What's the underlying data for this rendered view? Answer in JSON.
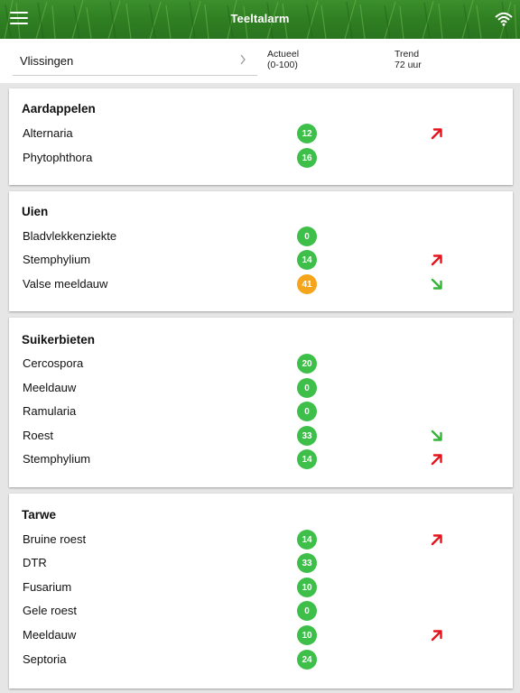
{
  "header": {
    "title": "Teeltalarm"
  },
  "location": {
    "name": "Vlissingen"
  },
  "columns": {
    "actueel": {
      "line1": "Actueel",
      "line2": "(0-100)"
    },
    "trend": {
      "line1": "Trend",
      "line2": "72 uur"
    }
  },
  "colors": {
    "green": "#3dbf4a",
    "orange": "#f4a51b",
    "arrow_up": "#e3141c",
    "arrow_down": "#35b43a"
  },
  "crops": [
    {
      "name": "Aardappelen",
      "diseases": [
        {
          "name": "Alternaria",
          "value": "12",
          "level": "green",
          "trend": "up"
        },
        {
          "name": "Phytophthora",
          "value": "16",
          "level": "green",
          "trend": ""
        }
      ]
    },
    {
      "name": "Uien",
      "diseases": [
        {
          "name": "Bladvlekkenziekte",
          "value": "0",
          "level": "green",
          "trend": ""
        },
        {
          "name": "Stemphylium",
          "value": "14",
          "level": "green",
          "trend": "up"
        },
        {
          "name": "Valse meeldauw",
          "value": "41",
          "level": "orange",
          "trend": "down"
        }
      ]
    },
    {
      "name": "Suikerbieten",
      "diseases": [
        {
          "name": "Cercospora",
          "value": "20",
          "level": "green",
          "trend": ""
        },
        {
          "name": "Meeldauw",
          "value": "0",
          "level": "green",
          "trend": ""
        },
        {
          "name": "Ramularia",
          "value": "0",
          "level": "green",
          "trend": ""
        },
        {
          "name": "Roest",
          "value": "33",
          "level": "green",
          "trend": "down"
        },
        {
          "name": "Stemphylium",
          "value": "14",
          "level": "green",
          "trend": "up"
        }
      ]
    },
    {
      "name": "Tarwe",
      "diseases": [
        {
          "name": "Bruine roest",
          "value": "14",
          "level": "green",
          "trend": "up"
        },
        {
          "name": "DTR",
          "value": "33",
          "level": "green",
          "trend": ""
        },
        {
          "name": "Fusarium",
          "value": "10",
          "level": "green",
          "trend": ""
        },
        {
          "name": "Gele roest",
          "value": "0",
          "level": "green",
          "trend": ""
        },
        {
          "name": "Meeldauw",
          "value": "10",
          "level": "green",
          "trend": "up"
        },
        {
          "name": "Septoria",
          "value": "24",
          "level": "green",
          "trend": ""
        }
      ]
    }
  ]
}
